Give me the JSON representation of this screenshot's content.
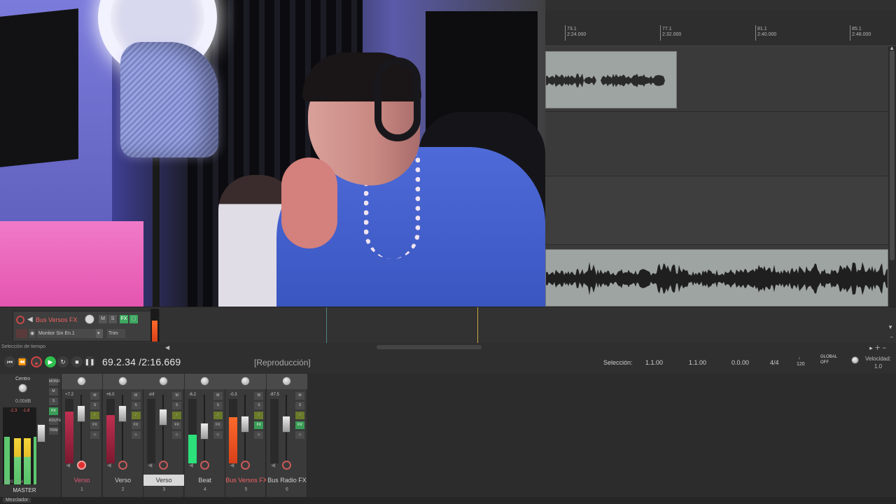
{
  "timeline": {
    "ticks": [
      {
        "bar": "73.1",
        "time": "2:24.000"
      },
      {
        "bar": "77.1",
        "time": "2:32.000"
      },
      {
        "bar": "81.1",
        "time": "2:40.000"
      },
      {
        "bar": "85.1",
        "time": "2:48.000"
      }
    ]
  },
  "track": {
    "name": "Bus Versos FX",
    "input_label": "Monitor Sin En.1",
    "trim_label": "Trim",
    "mute_label": "M",
    "solo_label": "S",
    "fx_label": "FX"
  },
  "transport": {
    "selection_area_label": "Selección de tiempo",
    "time": "69.2.34 /2:16.669",
    "state": "[Reproducción]",
    "selection_label": "Selección:",
    "selection_start": "1.1.00",
    "selection_end": "1.1.00",
    "selection_length": "0.0.00",
    "time_signature": "4/4",
    "tempo": "120",
    "global_label": "GLOBAL",
    "global_state": "OFF",
    "speed_label": "Velocidad:",
    "speed_value": "1.0"
  },
  "master": {
    "pan_label": "Centro",
    "volume": "0.00dB",
    "peak_left": "-2.3",
    "peak_right": "-1.8",
    "rms_label": "RMS",
    "rms_value": "-8.4",
    "name": "MASTER",
    "buttons": [
      "MONO",
      "M",
      "S",
      "FX",
      "ROUTE",
      "TRIM"
    ],
    "meter_level": 0.6
  },
  "mixer_tab": "Mezclador",
  "channels": [
    {
      "name": "Verso",
      "number": "1",
      "volume": "+7.2",
      "color": "#e05a78",
      "armed": true,
      "meter_level": 0.8,
      "fader_level": 0.85
    },
    {
      "name": "Verso",
      "number": "2",
      "volume": "+6.0",
      "color": "#cfcfcf",
      "armed": false,
      "meter_level": 0.75,
      "fader_level": 0.85
    },
    {
      "name": "Verso",
      "number": "3",
      "volume": "-inf",
      "color": "#333333",
      "armed": false,
      "meter_level": 0.0,
      "fader_level": 0.8,
      "selected": true
    },
    {
      "name": "Beat",
      "number": "4",
      "volume": "-6.2",
      "color": "#cfcfcf",
      "armed": false,
      "meter_level": 0.45,
      "fader_level": 0.6
    },
    {
      "name": "Bus Versos FX",
      "number": "5",
      "volume": "-0.3",
      "color": "#f06464",
      "armed": false,
      "meter_level": 0.72,
      "fader_level": 0.7
    },
    {
      "name": "Bus Radio FX",
      "number": "6",
      "volume": "-87.5",
      "color": "#cfcfcf",
      "armed": false,
      "meter_level": 0.0,
      "fader_level": 0.7
    }
  ],
  "strip_buttons": {
    "mute": "M",
    "solo": "S",
    "fx": "FX"
  },
  "colors": {
    "accent_green": "#2fbf4e",
    "record_red": "#d24444",
    "meter_orange": "#e8521e",
    "meter_green": "#2ce07a"
  }
}
